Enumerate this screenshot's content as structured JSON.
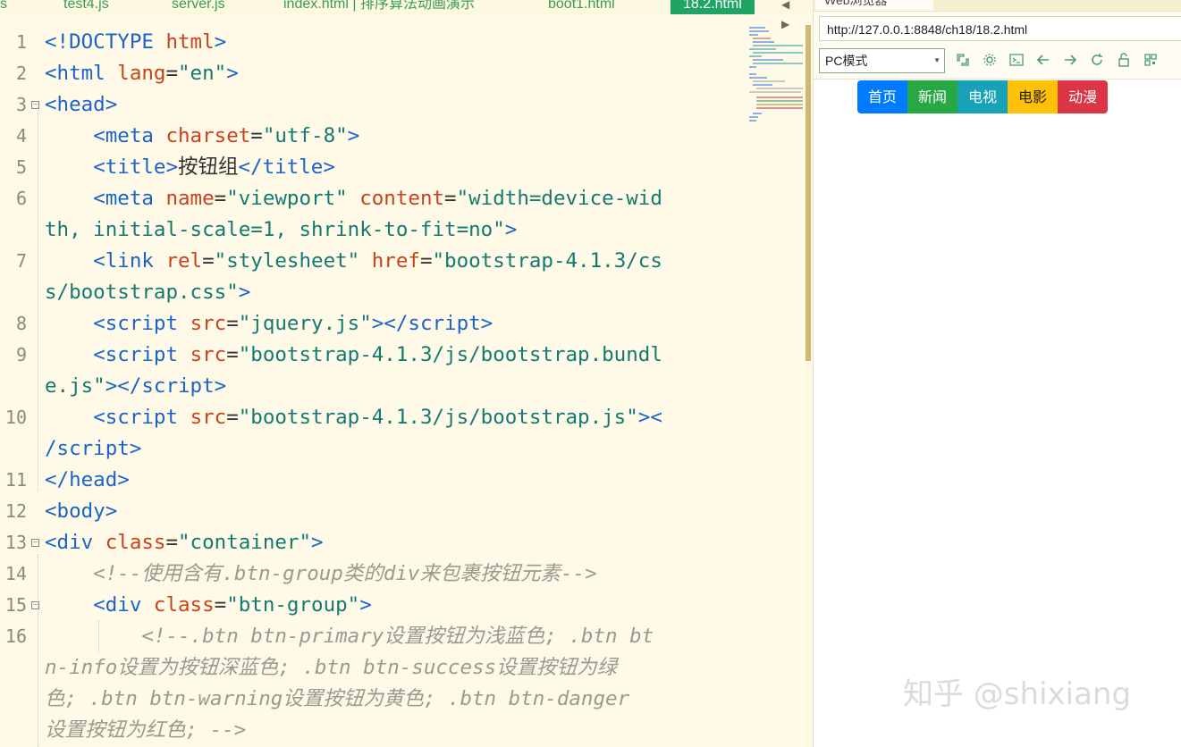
{
  "editor": {
    "tabs": [
      {
        "label": "s"
      },
      {
        "label": "test4.js"
      },
      {
        "label": "server.js"
      },
      {
        "label": "index.html | 排序算法动画演示"
      },
      {
        "label": "boot1.html"
      },
      {
        "label": "18.2.html",
        "active": true
      }
    ],
    "tab_nav": "◀ ▶",
    "lines": [
      {
        "n": "1"
      },
      {
        "n": "2"
      },
      {
        "n": "3"
      },
      {
        "n": "4"
      },
      {
        "n": "5"
      },
      {
        "n": "6"
      },
      {
        "n": ""
      },
      {
        "n": "7"
      },
      {
        "n": ""
      },
      {
        "n": "8"
      },
      {
        "n": "9"
      },
      {
        "n": ""
      },
      {
        "n": "10"
      },
      {
        "n": ""
      },
      {
        "n": "11"
      },
      {
        "n": "12"
      },
      {
        "n": "13"
      },
      {
        "n": "14"
      },
      {
        "n": "15"
      },
      {
        "n": "16"
      },
      {
        "n": ""
      },
      {
        "n": ""
      },
      {
        "n": ""
      }
    ]
  },
  "browser": {
    "tab_title": "Web浏览器",
    "url": "http://127.0.0.1:8848/ch18/18.2.html",
    "mode": "PC模式",
    "toolbar_icons": [
      "fullscreen-icon",
      "settings-icon",
      "console-icon",
      "back-icon",
      "forward-icon",
      "refresh-icon",
      "lock-icon",
      "qrcode-icon"
    ],
    "buttons": [
      "首页",
      "新闻",
      "电视",
      "电影",
      "动漫"
    ],
    "button_colors": [
      "#007bff",
      "#28a745",
      "#17a2b8",
      "#ffc107",
      "#dc3545"
    ]
  },
  "watermark": "知乎 @shixiang"
}
